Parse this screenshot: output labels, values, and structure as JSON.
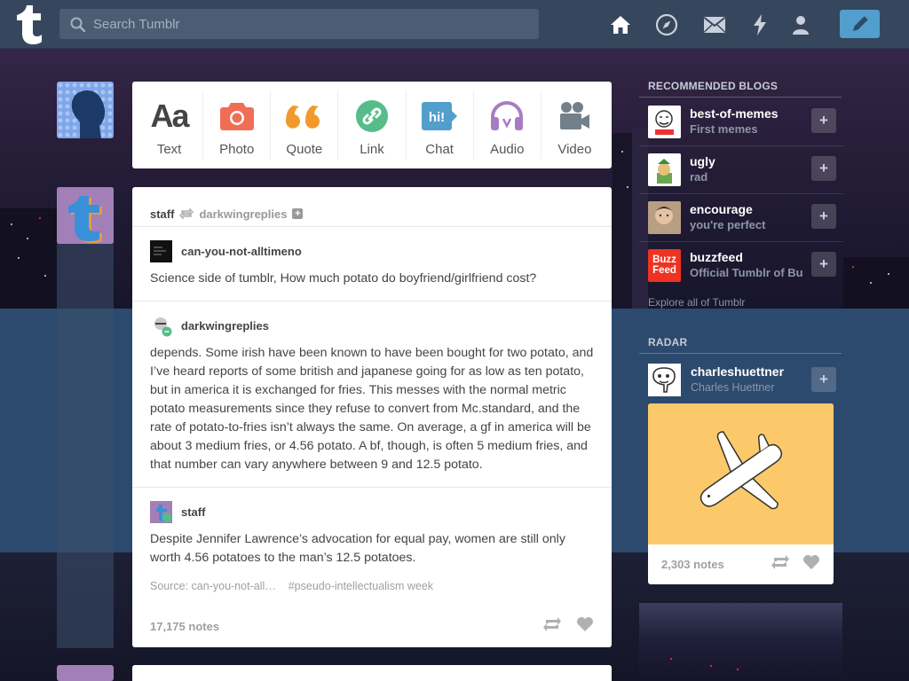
{
  "header": {
    "search_placeholder": "Search Tumblr",
    "nav": [
      {
        "icon": "home-icon",
        "active": true
      },
      {
        "icon": "explore-compass-icon"
      },
      {
        "icon": "inbox-envelope-icon"
      },
      {
        "icon": "activity-lightning-icon"
      },
      {
        "icon": "account-person-icon"
      }
    ],
    "compose_icon": "pencil-icon"
  },
  "post_types": [
    {
      "label": "Text",
      "icon": "text-aa-icon",
      "color": "#444444"
    },
    {
      "label": "Photo",
      "icon": "camera-icon",
      "color": "#f06e56"
    },
    {
      "label": "Quote",
      "icon": "quote-icon",
      "color": "#f2992e"
    },
    {
      "label": "Link",
      "icon": "link-icon",
      "color": "#56bc8a"
    },
    {
      "label": "Chat",
      "icon": "chat-bubble-icon",
      "color": "#529ecc"
    },
    {
      "label": "Audio",
      "icon": "headphones-icon",
      "color": "#a77dc2"
    },
    {
      "label": "Video",
      "icon": "video-camera-icon",
      "color": "#748089"
    }
  ],
  "post": {
    "author": "staff",
    "reblogged_from": "darkwingreplies",
    "trail": [
      {
        "user": "can-you-not-alltimeno",
        "text": "Science side of tumblr, How much potato do boyfriend/girlfriend cost?"
      },
      {
        "user": "darkwingreplies",
        "text": "depends. Some irish have been known to have been bought for two potato, and I’ve heard reports of some british and japanese going for as low as ten potato, but in america it is exchanged for fries. This messes with the normal metric potato measurements since they refuse to convert from Mc.standard, and the rate of potato-to-fries isn’t always the same. On average, a gf in america will be about 3 medium fries, or 4.56 potato. A bf, though, is often 5 medium fries, and that number can vary anywhere between 9 and 12.5 potato."
      },
      {
        "user": "staff",
        "text": "Despite Jennifer Lawrence’s advocation for equal pay, women are still only worth 4.56 potatoes to the man’s 12.5 potatoes."
      }
    ],
    "source": "Source: can-you-not-all…",
    "tag": "#pseudo-intellectualism week",
    "notes": "17,175 notes"
  },
  "sidebar": {
    "recommended_title": "RECOMMENDED BLOGS",
    "blogs": [
      {
        "name": "best-of-memes",
        "subtitle": "First memes"
      },
      {
        "name": "ugly",
        "subtitle": "rad"
      },
      {
        "name": "encourage",
        "subtitle": "you're perfect"
      },
      {
        "name": "buzzfeed",
        "subtitle": "Official Tumblr of Bu",
        "avatar_text": "Buzz Feed"
      }
    ],
    "explore_link": "Explore all of Tumblr",
    "radar_title": "RADAR",
    "radar": {
      "name": "charleshuettner",
      "subtitle": "Charles Huettner",
      "notes": "2,303 notes"
    }
  },
  "colors": {
    "header": "#36465d",
    "accent": "#529ecc",
    "background": "#2c4a6e"
  }
}
